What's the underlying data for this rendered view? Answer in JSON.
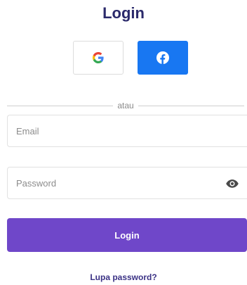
{
  "title": "Login",
  "social": {
    "google_glyph": "G",
    "google_icon": "google-icon",
    "facebook_icon": "facebook-icon",
    "facebook_color": "#1877f2"
  },
  "divider_text": "atau",
  "email": {
    "placeholder": "Email",
    "value": ""
  },
  "password": {
    "placeholder": "Password",
    "value": "",
    "toggle_icon": "eye-icon"
  },
  "login_button": {
    "label": "Login",
    "color": "#6f47c9"
  },
  "forgot_link": "Lupa password?",
  "colors": {
    "title": "#2b2a6b",
    "link": "#3b3285"
  }
}
